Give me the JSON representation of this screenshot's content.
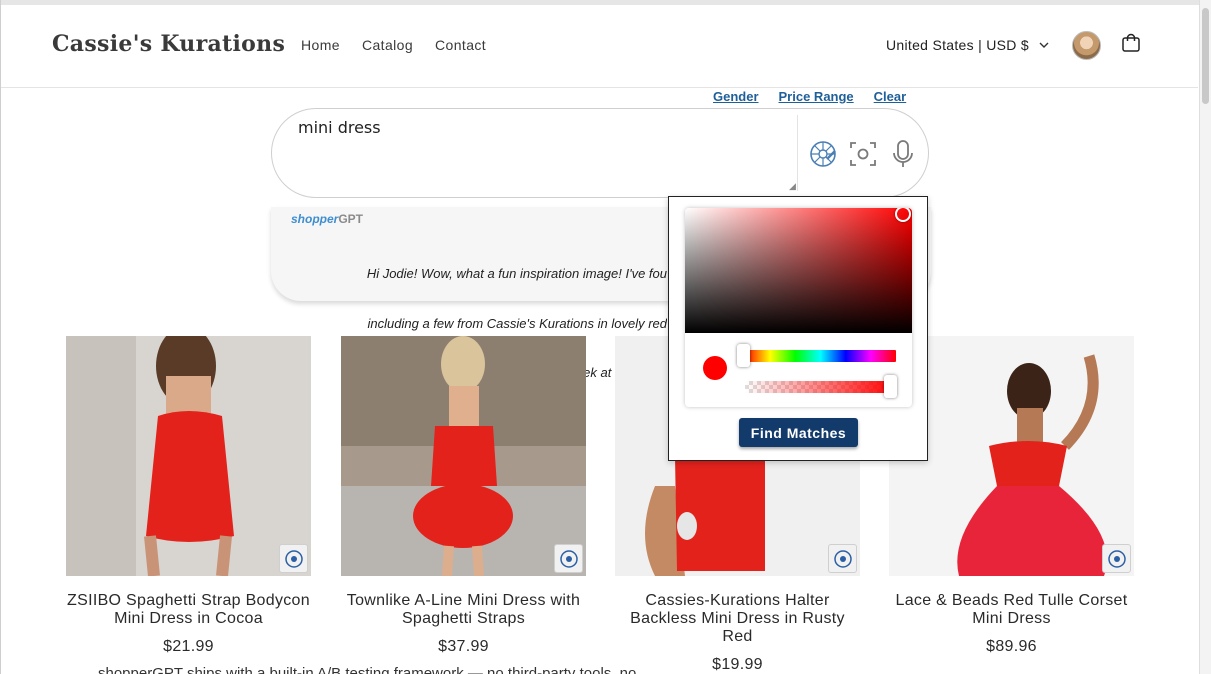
{
  "header": {
    "logo": "Cassie's Kurations",
    "nav": [
      "Home",
      "Catalog",
      "Contact"
    ],
    "locale": "United States | USD $",
    "icons": [
      "chevron-down-icon",
      "avatar",
      "cart-icon"
    ]
  },
  "filters": [
    "Gender",
    "Price Range",
    "Clear"
  ],
  "search": {
    "value": "mini dress",
    "icons": [
      "color-wheel-icon",
      "camera-scan-icon",
      "microphone-icon"
    ]
  },
  "gpt": {
    "brand_part1": "shopper",
    "brand_part2": "GPT",
    "message_lines": [
      "Hi Jodie! Wow, what a fun inspiration image! I've fou",
      "including a few from Cassie's Kurations in lovely red",
      "Come take a peek at these vib"
    ]
  },
  "products": [
    {
      "title": "ZSIIBO Spaghetti Strap Bodycon Mini Dress in Cocoa",
      "price": "$21.99"
    },
    {
      "title": "Townlike A-Line Mini Dress with Spaghetti Straps",
      "price": "$37.99"
    },
    {
      "title": "Cassies-Kurations Halter Backless Mini Dress in Rusty Red",
      "price": "$19.99"
    },
    {
      "title": "Lace & Beads Red Tulle Corset Mini Dress",
      "price": "$89.96"
    }
  ],
  "bottom_text": "shopperGPT ships with a built-in A/B testing framework — no third-party tools, no",
  "picker": {
    "button": "Find Matches",
    "selected_color": "#ff0000",
    "hue_level": 0,
    "alpha_level": 1
  },
  "colors": {
    "accent": "#123a6b",
    "link": "#1f5f99",
    "product_red": "#e3221c"
  }
}
